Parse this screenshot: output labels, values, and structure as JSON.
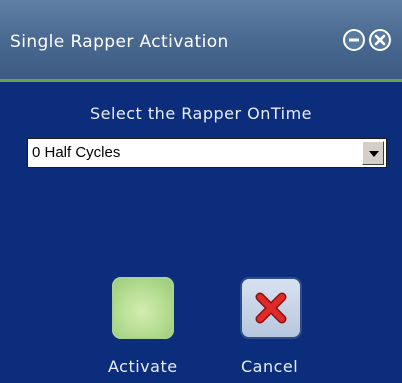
{
  "window": {
    "title": "Single Rapper Activation",
    "title_buttons": [
      "minimize-icon",
      "close-icon"
    ]
  },
  "main": {
    "prompt": "Select the Rapper OnTime",
    "dropdown": {
      "selected": "0 Half Cycles"
    },
    "buttons": {
      "activate_label": "Activate",
      "cancel_label": "Cancel"
    }
  },
  "colors": {
    "background": "#0c2c7c",
    "titlebar": "#4b6b92",
    "accent_line": "#6aa34a",
    "activate_button": "#b8df94",
    "cancel_x": "#d42020"
  }
}
